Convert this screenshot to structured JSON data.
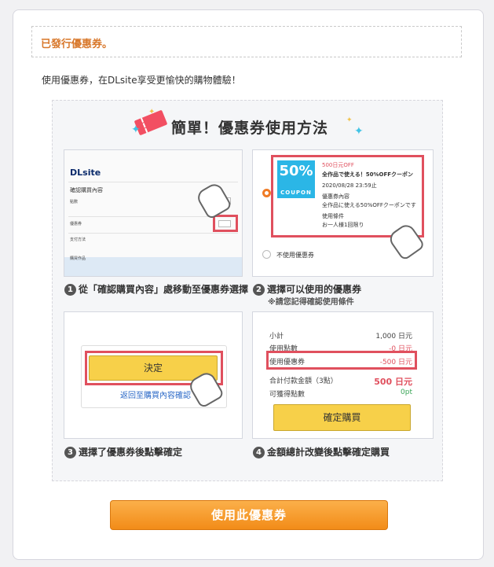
{
  "notice": {
    "text": "已發行優惠券。"
  },
  "intro": {
    "text": "使用優惠券，在DLsite享受更愉快的購物體驗！"
  },
  "guide": {
    "title": "簡單！優惠券使用方法",
    "steps": [
      {
        "num": "1",
        "label": "從「確認購買內容」處移動至優惠券選擇"
      },
      {
        "num": "2",
        "label": "選擇可以使用的優惠券",
        "sub": "※請您記得確認使用條件"
      },
      {
        "num": "3",
        "label": "選擇了優惠券後點擊確定"
      },
      {
        "num": "4",
        "label": "金額總計改變後點擊確定購買"
      }
    ],
    "panel1": {
      "logo": "DLsite",
      "section": "確認購買內容",
      "row1": "點數",
      "row2": "優惠券",
      "row3": "支付方法",
      "footer": "購買作品"
    },
    "panel2": {
      "badge_big": "50%",
      "badge_off": "OFF",
      "badge_small": "COUPON",
      "title_red": "500日元OFF",
      "title": "全作品で使える！50%OFFクーポン",
      "expiry": "2020/08/28 23:59止",
      "content_label": "優惠券內容",
      "content": "全作品に使える50%OFFクーポンです",
      "cond_label": "使用條件",
      "cond": "お一人様1回限り",
      "none_label": "不使用優惠券"
    },
    "panel3": {
      "decide": "決定",
      "back": "返回至購買內容確認"
    },
    "panel4": {
      "rows": [
        {
          "label": "小計",
          "value": "1,000 日元"
        },
        {
          "label": "使用點數",
          "value": "-0 日元"
        },
        {
          "label": "使用優惠券",
          "value": "-500 日元"
        },
        {
          "label": "合計付款金額（3點）",
          "value": "500 日元"
        },
        {
          "label": "可獲得點數",
          "value": "0pt"
        }
      ],
      "confirm": "確定購買"
    }
  },
  "button": {
    "label": "使用此優惠券"
  }
}
